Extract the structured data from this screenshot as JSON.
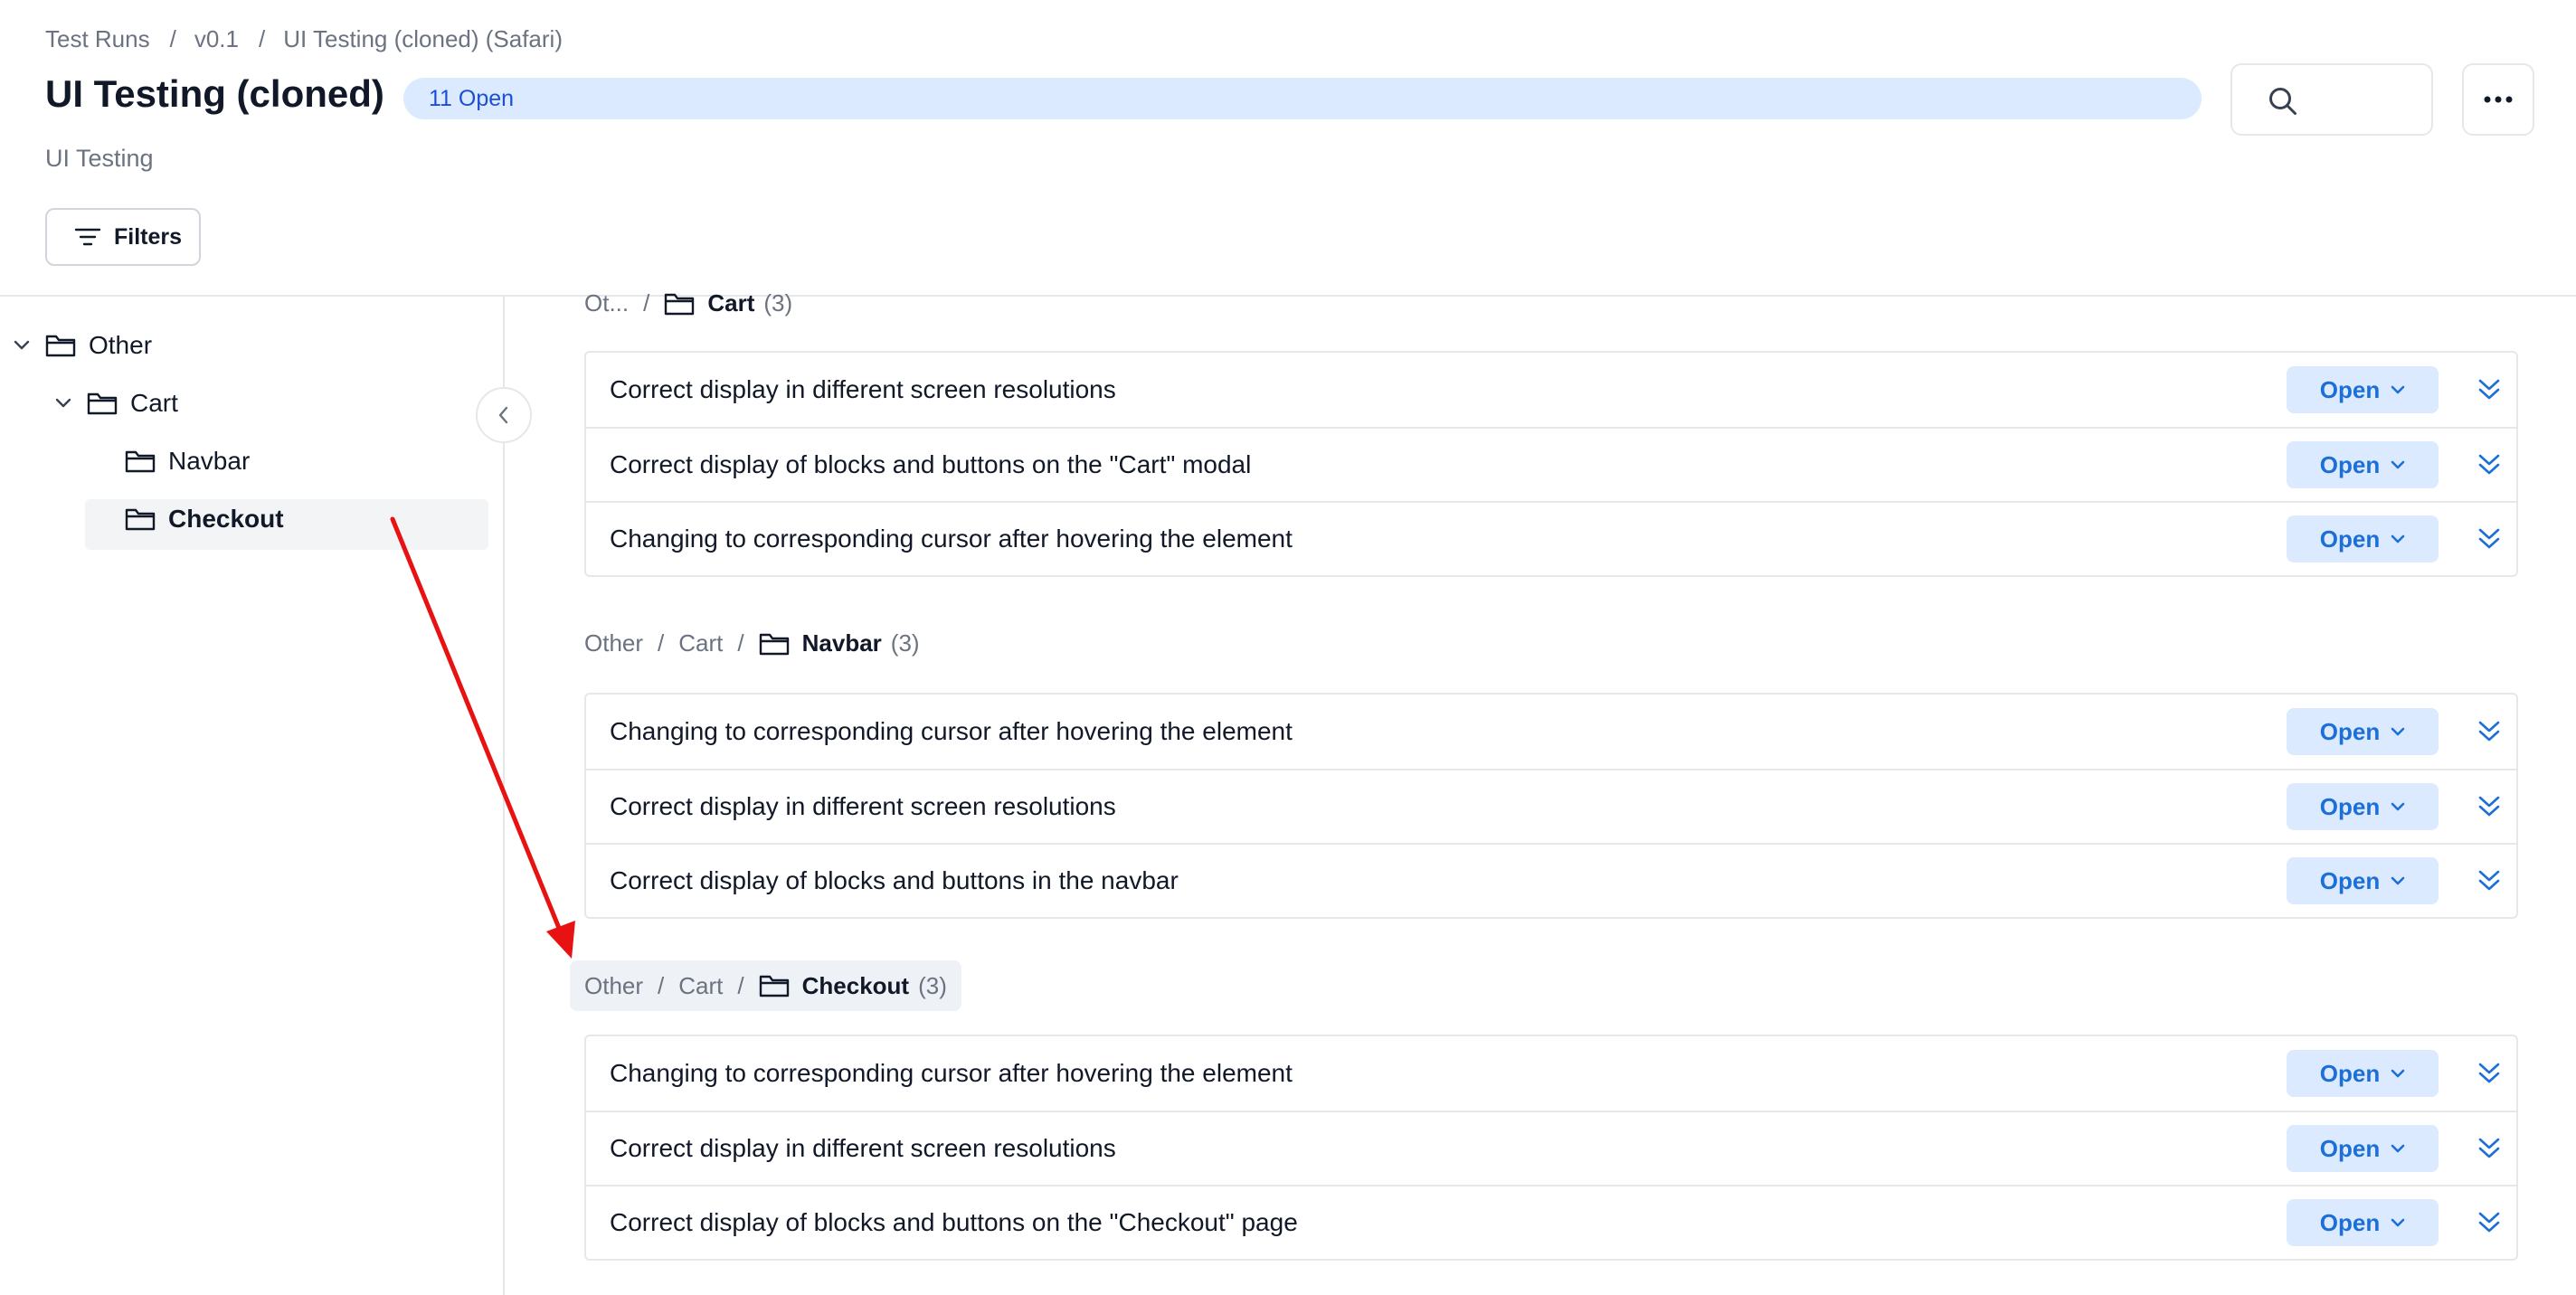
{
  "breadcrumb": [
    "Test Runs",
    "v0.1",
    "UI Testing (cloned) (Safari)"
  ],
  "breadcrumb_sep": "/",
  "page": {
    "title": "UI Testing (cloned)",
    "badge": "11 Open",
    "subtitle": "UI Testing",
    "filters_label": "Filters"
  },
  "tree": {
    "root": "Other",
    "child": "Cart",
    "grandchildren": [
      "Navbar",
      "Checkout"
    ],
    "selected": "Checkout"
  },
  "groups": [
    {
      "crumb_prefix": [
        "Ot..."
      ],
      "folder": "Cart",
      "count": "(3)",
      "rows": [
        {
          "title": "Correct display in different screen resolutions",
          "status": "Open"
        },
        {
          "title": "Correct display of blocks and buttons on the \"Cart\" modal",
          "status": "Open"
        },
        {
          "title": "Changing to corresponding cursor after hovering the element",
          "status": "Open"
        }
      ]
    },
    {
      "crumb_prefix": [
        "Other",
        "Cart"
      ],
      "folder": "Navbar",
      "count": "(3)",
      "rows": [
        {
          "title": "Changing to corresponding cursor after hovering the element",
          "status": "Open"
        },
        {
          "title": "Correct display in different screen resolutions",
          "status": "Open"
        },
        {
          "title": "Correct display of blocks and buttons in the navbar",
          "status": "Open"
        }
      ]
    },
    {
      "crumb_prefix": [
        "Other",
        "Cart"
      ],
      "folder": "Checkout",
      "count": "(3)",
      "rows": [
        {
          "title": "Changing to corresponding cursor after hovering the element",
          "status": "Open"
        },
        {
          "title": "Correct display in different screen resolutions",
          "status": "Open"
        },
        {
          "title": "Correct display of blocks and buttons on the \"Checkout\" page",
          "status": "Open"
        }
      ]
    }
  ],
  "colors": {
    "accent": "#1d6fd8",
    "badge_bg": "#dbeafe",
    "annotation_arrow": "#e81212"
  },
  "icons": [
    "search-icon",
    "more-icon",
    "filter-icon",
    "folder-icon",
    "chevron-down-icon",
    "chevron-left-icon",
    "double-chevron-down-icon"
  ]
}
